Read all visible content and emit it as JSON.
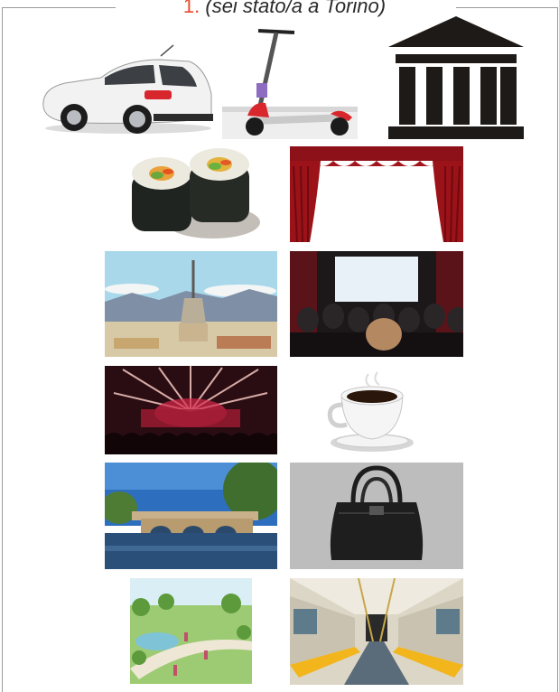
{
  "exercise": {
    "number": "1.",
    "hint": "(sei stato/a a Torino)"
  },
  "images": [
    {
      "name": "car-image"
    },
    {
      "name": "scooter-image"
    },
    {
      "name": "museum-icon"
    },
    {
      "name": "sushi-image"
    },
    {
      "name": "theater-curtain-image"
    },
    {
      "name": "mole-antonelliana-image"
    },
    {
      "name": "cinema-image"
    },
    {
      "name": "concert-image"
    },
    {
      "name": "coffee-cup-image"
    },
    {
      "name": "river-bridge-image"
    },
    {
      "name": "handbag-image"
    },
    {
      "name": "park-image"
    },
    {
      "name": "metro-train-image"
    }
  ]
}
